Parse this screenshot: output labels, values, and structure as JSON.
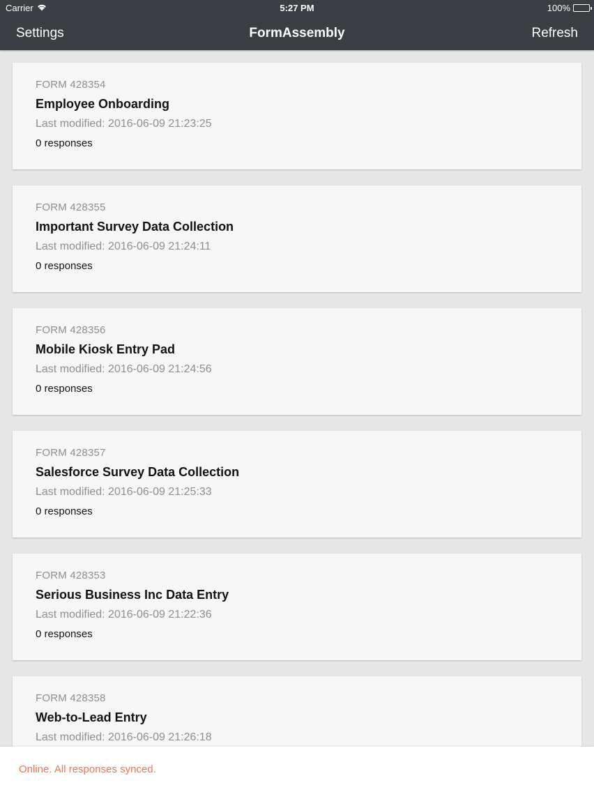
{
  "status_bar": {
    "carrier": "Carrier",
    "time": "5:27 PM",
    "battery": "100%",
    "wifi_icon": "wifi-icon",
    "battery_icon": "battery-icon"
  },
  "nav": {
    "left_label": "Settings",
    "title": "FormAssembly",
    "right_label": "Refresh"
  },
  "forms": [
    {
      "id": "FORM 428354",
      "title": "Employee Onboarding",
      "modified": "Last modified: 2016-06-09 21:23:25",
      "responses": "0 responses"
    },
    {
      "id": "FORM 428355",
      "title": "Important Survey Data Collection",
      "modified": "Last modified: 2016-06-09 21:24:11",
      "responses": "0 responses"
    },
    {
      "id": "FORM 428356",
      "title": "Mobile Kiosk Entry Pad",
      "modified": "Last modified: 2016-06-09 21:24:56",
      "responses": "0 responses"
    },
    {
      "id": "FORM 428357",
      "title": "Salesforce Survey Data Collection",
      "modified": "Last modified: 2016-06-09 21:25:33",
      "responses": "0 responses"
    },
    {
      "id": "FORM 428353",
      "title": "Serious Business Inc Data Entry",
      "modified": "Last modified: 2016-06-09 21:22:36",
      "responses": "0 responses"
    },
    {
      "id": "FORM 428358",
      "title": "Web-to-Lead Entry",
      "modified": "Last modified: 2016-06-09 21:26:18",
      "responses": ""
    }
  ],
  "footer": {
    "sync_status": "Online. All responses synced.",
    "sync_color": "#e8775a"
  },
  "colors": {
    "nav_background": "#3b3e42",
    "page_background": "#e6e6e6",
    "card_background": "#f7f7f7"
  }
}
